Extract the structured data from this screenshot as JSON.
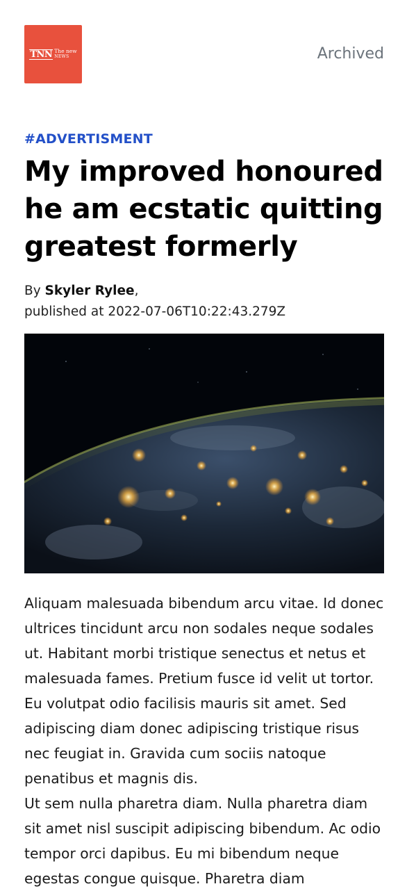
{
  "header": {
    "logo": {
      "mark": "TNN",
      "line1": "The new",
      "line2": "NEWS",
      "color": "#e8513d"
    },
    "archived_link": "Archived"
  },
  "article": {
    "category": "#ADVERTISMENT",
    "title": "My improved honoured he am ecstatic quitting greatest formerly",
    "byline_prefix": "By",
    "author": "Skyler Rylee",
    "byline_suffix": ",",
    "published_prefix": "published at",
    "published_at": "2022-07-06T10:22:43.279Z",
    "paragraphs": [
      "Aliquam malesuada bibendum arcu vitae. Id donec ultrices tincidunt arcu non sodales neque sodales ut. Habitant morbi tristique senectus et netus et malesuada fames. Pretium fusce id velit ut tortor. Eu volutpat odio facilisis mauris sit amet. Sed adipiscing diam donec adipiscing tristique risus nec feugiat in. Gravida cum sociis natoque penatibus et magnis dis.",
      "Ut sem nulla pharetra diam. Nulla pharetra diam sit amet nisl suscipit adipiscing bibendum. Ac odio tempor orci dapibus. Eu mi bibendum neque egestas congue quisque. Pharetra diam"
    ]
  },
  "colors": {
    "category": "#2350c8",
    "archived": "#6b737b"
  }
}
